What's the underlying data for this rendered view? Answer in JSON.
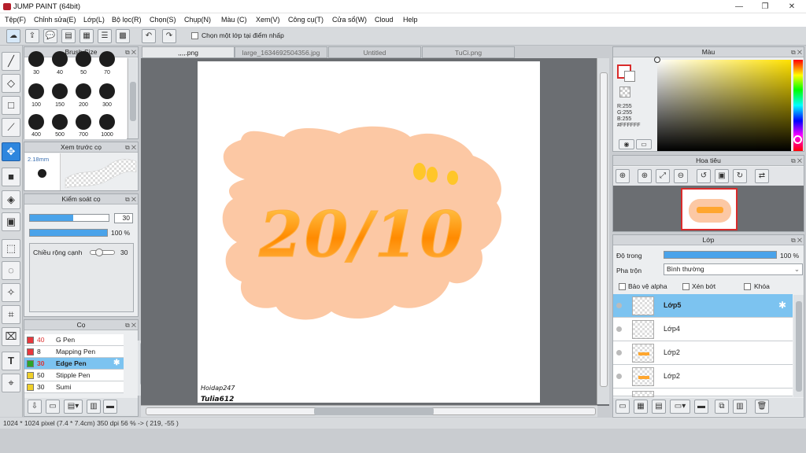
{
  "window": {
    "title": "JUMP PAINT (64bit)",
    "minimize": "—",
    "maximize": "❐",
    "close": "✕"
  },
  "menu": [
    "Tệp(F)",
    "Chỉnh sửa(E)",
    "Lớp(L)",
    "Bộ lọc(R)",
    "Chọn(S)",
    "Chụp(N)",
    "Màu (C)",
    "Xem(V)",
    "Công cụ(T)",
    "Cửa sổ(W)",
    "Cloud",
    "Help"
  ],
  "toolbar": {
    "select_layer_label": "Chọn một lớp tại điểm nhấp"
  },
  "tabs": [
    ",,,,.png",
    "large_1634692504356.jpg",
    "Untitled",
    "TuCi.png"
  ],
  "brush_size": {
    "title": "Brush Size",
    "sizes": [
      "30",
      "40",
      "50",
      "70",
      "100",
      "150",
      "200",
      "300",
      "400",
      "500",
      "700",
      "1000"
    ]
  },
  "preview": {
    "title": "Xem trước cọ",
    "size_label": "2.18mm"
  },
  "brush_control": {
    "title": "Kiểm soát cọ",
    "size_value": "30",
    "opacity_value": "100 %",
    "width_label": "Chiều rộng cạnh",
    "width_value": "30"
  },
  "pens": {
    "title": "Cọ",
    "items": [
      {
        "num": "40",
        "name": "G Pen",
        "color": "#e8383d"
      },
      {
        "num": "8",
        "name": "Mapping Pen",
        "color": "#e8383d"
      },
      {
        "num": "30",
        "name": "Edge Pen",
        "color": "#2aa52a"
      },
      {
        "num": "50",
        "name": "Stipple Pen",
        "color": "#f0d02a"
      },
      {
        "num": "30",
        "name": "Sumi",
        "color": "#f0d02a"
      }
    ]
  },
  "canvas_art": {
    "main_text": "20/10",
    "sign_line1": "Hoidap247",
    "sign_line2": "Tulia612"
  },
  "color_panel": {
    "title": "Màu",
    "r": "R:255",
    "g": "G:255",
    "b": "B:255",
    "hex": "#FFFFFF"
  },
  "navigator": {
    "title": "Hoa tiêu"
  },
  "layers": {
    "title": "Lớp",
    "opacity_label": "Độ trong",
    "opacity_value": "100 %",
    "blend_label": "Pha trộn",
    "blend_value": "Bình thường",
    "alpha_protect": "Bảo vệ alpha",
    "clipping": "Xén bớt",
    "lock": "Khóa",
    "items": [
      {
        "name": "Lớp5"
      },
      {
        "name": "Lớp4"
      },
      {
        "name": "Lớp2"
      },
      {
        "name": "Lớp2"
      }
    ]
  },
  "status": {
    "info": "1024 * 1024 pixel   (7.4 * 7.4cm)   350 dpi   56 %   -> ( 219, -55 )"
  },
  "colors": {
    "accent": "#2e86de",
    "selection": "#7cc3f0",
    "cloud": "#fcc8a4",
    "text_orange": "#ff9a1a"
  }
}
